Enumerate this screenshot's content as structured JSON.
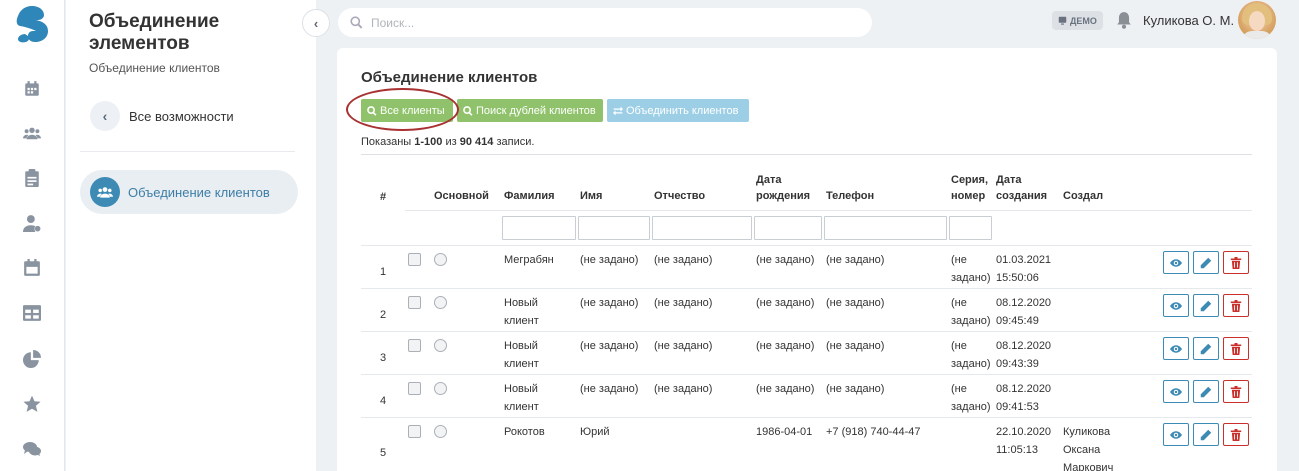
{
  "sidebar": {
    "title": "Объединение элементов",
    "subtitle": "Объединение клиентов",
    "back_label": "Все возможности",
    "active_label": "Объединение клиентов"
  },
  "topbar": {
    "search_placeholder": "Поиск...",
    "demo_badge": "ДЕМО",
    "user_name": "Куликова О. М."
  },
  "card": {
    "title": "Объединение клиентов",
    "buttons": {
      "all_clients": "Все клиенты",
      "find_duplicates": "Поиск дублей клиентов",
      "merge_clients": "Объединить клиентов"
    },
    "summary": {
      "prefix": "Показаны",
      "range": "1-100",
      "middle": "из",
      "total": "90 414",
      "suffix": "записи."
    }
  },
  "table": {
    "columns": {
      "num": "#",
      "main": "Основной",
      "lastname": "Фамилия",
      "firstname": "Имя",
      "patronymic": "Отчество",
      "birthdate": "Дата рождения",
      "phone": "Телефон",
      "series": "Серия, номер",
      "created": "Дата создания",
      "author": "Создал"
    },
    "rows": [
      {
        "num": "1",
        "lastname": "Меграбян",
        "firstname": "(не задано)",
        "patronymic": "(не задано)",
        "birthdate": "(не задано)",
        "phone": "(не задано)",
        "series": "(не задано)",
        "created": "01.03.2021 15:50:06",
        "author": ""
      },
      {
        "num": "2",
        "lastname": "Новый клиент",
        "firstname": "(не задано)",
        "patronymic": "(не задано)",
        "birthdate": "(не задано)",
        "phone": "(не задано)",
        "series": "(не задано)",
        "created": "08.12.2020 09:45:49",
        "author": ""
      },
      {
        "num": "3",
        "lastname": "Новый клиент",
        "firstname": "(не задано)",
        "patronymic": "(не задано)",
        "birthdate": "(не задано)",
        "phone": "(не задано)",
        "series": "(не задано)",
        "created": "08.12.2020 09:43:39",
        "author": ""
      },
      {
        "num": "4",
        "lastname": "Новый клиент",
        "firstname": "(не задано)",
        "patronymic": "(не задано)",
        "birthdate": "(не задано)",
        "phone": "(не задано)",
        "series": "(не задано)",
        "created": "08.12.2020 09:41:53",
        "author": ""
      },
      {
        "num": "5",
        "lastname": "Рокотов",
        "firstname": "Юрий",
        "patronymic": "",
        "birthdate": "1986-04-01",
        "phone": "+7 (918) 740-44-47",
        "series": "",
        "created": "22.10.2020 11:05:13",
        "author": "Куликова Оксана Маркович"
      }
    ]
  },
  "colors": {
    "accent_blue": "#3d8bb5",
    "button_green": "#8fc26a",
    "button_light_blue": "#9ccfe6",
    "delete_red": "#c9302c",
    "highlight_circle": "#a83232"
  },
  "icons": [
    "calendar-icon",
    "users-icon",
    "clipboard-icon",
    "user-settings-icon",
    "calendar-alt-icon",
    "table-icon",
    "pie-chart-icon",
    "star-icon",
    "chat-icon",
    "search-icon",
    "bell-icon",
    "eye-icon",
    "pencil-icon",
    "trash-icon",
    "exchange-icon"
  ]
}
